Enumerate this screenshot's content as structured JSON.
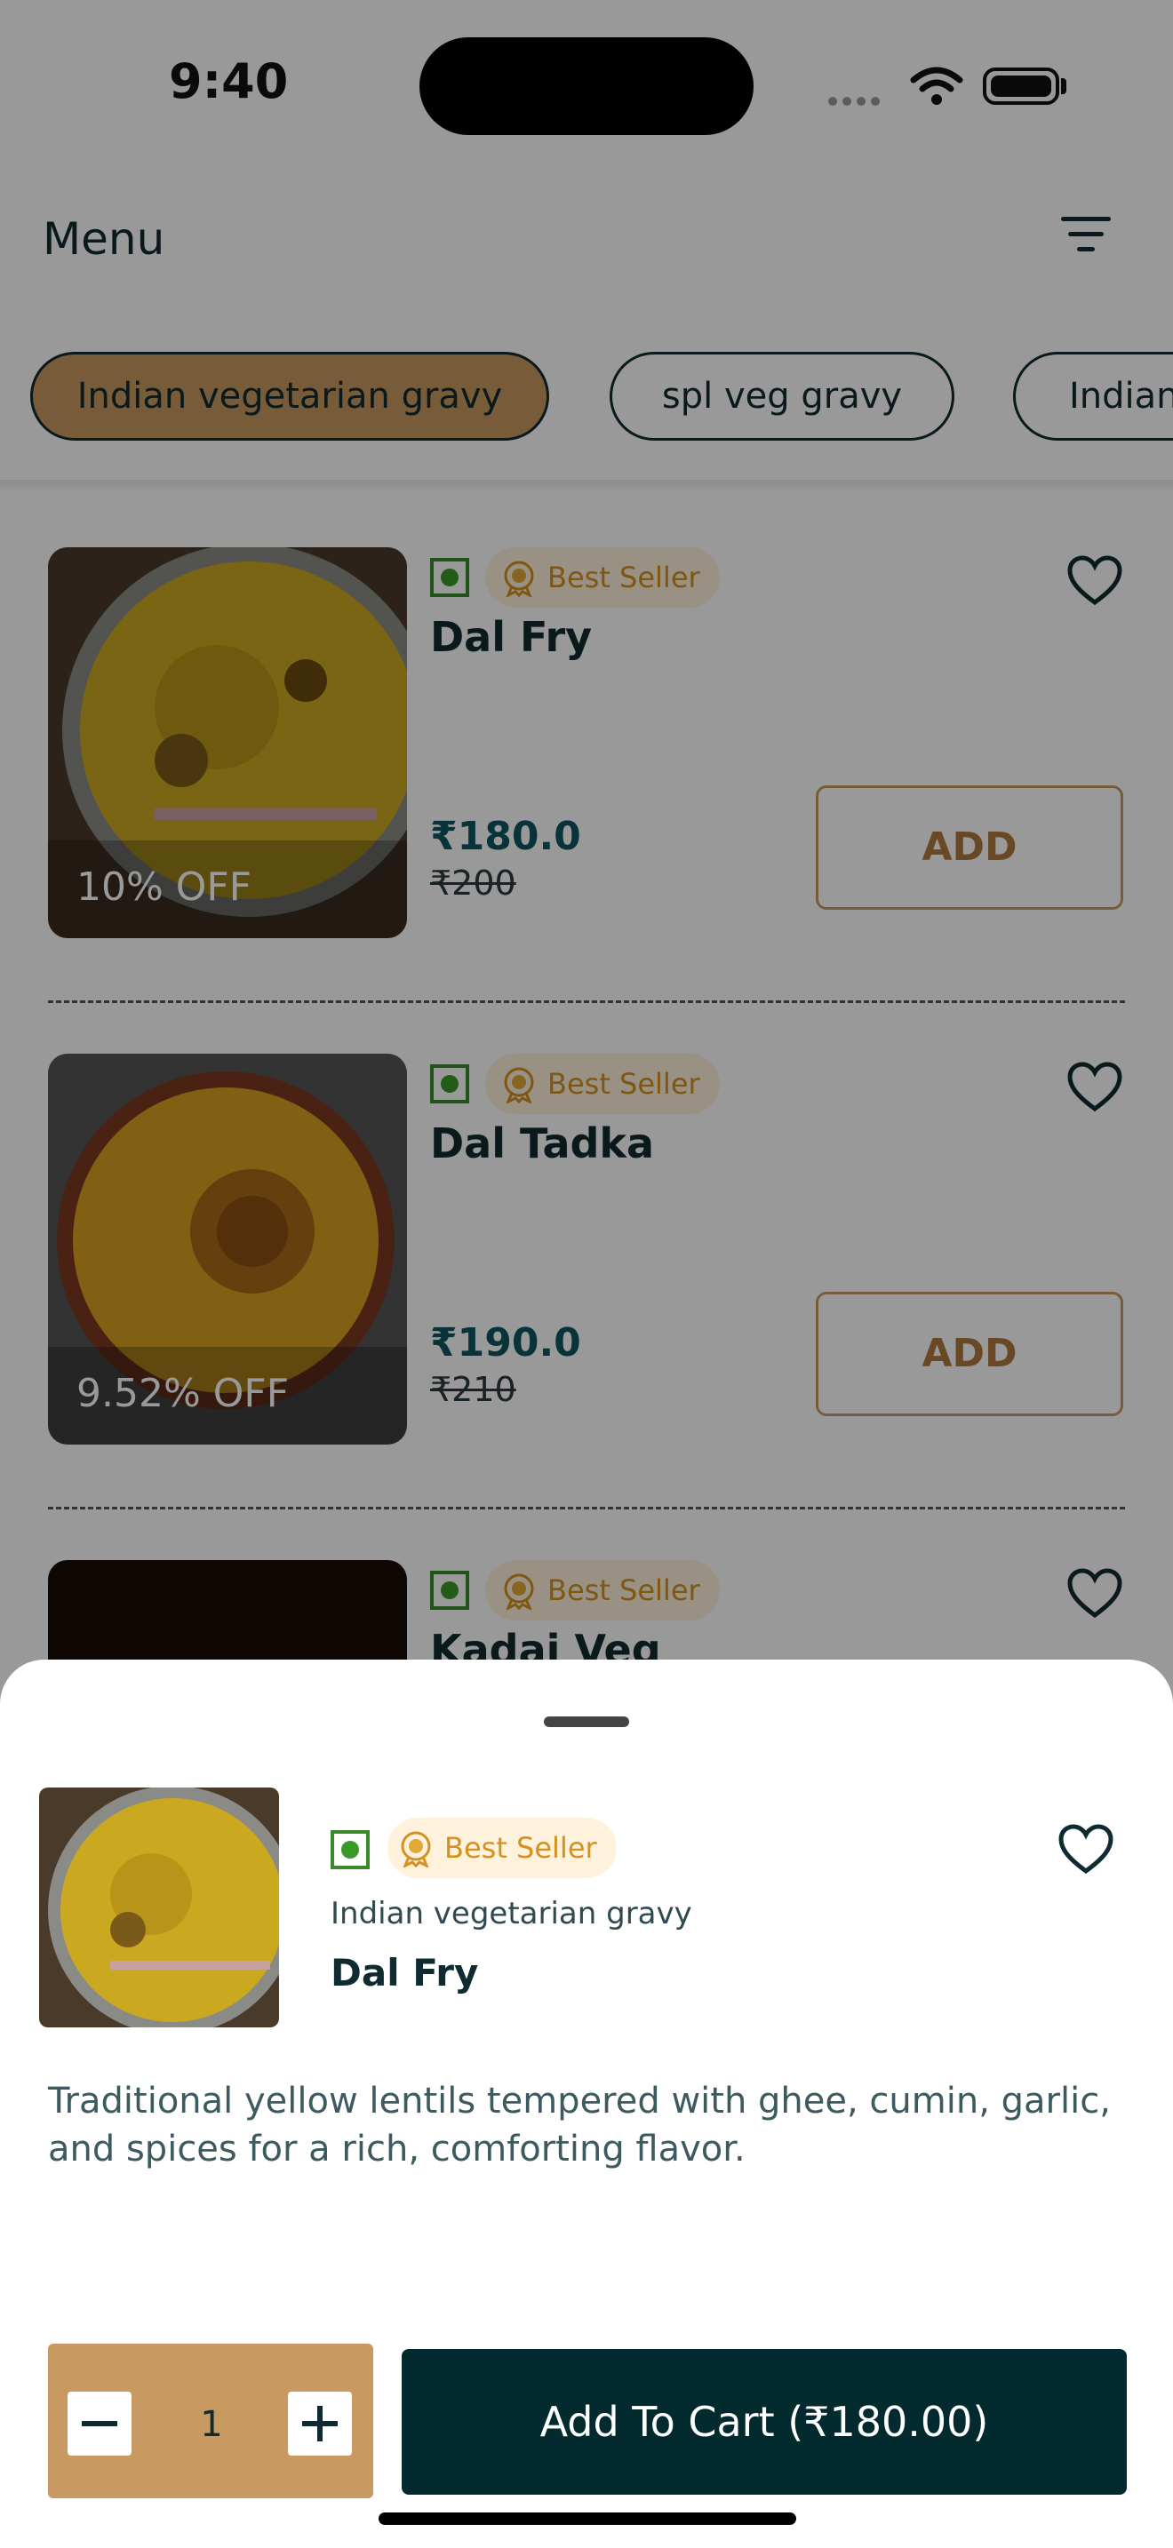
{
  "status_bar": {
    "time": "9:40"
  },
  "header": {
    "title": "Menu"
  },
  "categories": [
    {
      "label": "Indian vegetarian gravy",
      "active": true
    },
    {
      "label": "spl veg gravy",
      "active": false
    },
    {
      "label": "Indian",
      "active": false
    }
  ],
  "items": [
    {
      "name": "Dal Fry",
      "badge": "Best Seller",
      "price": "₹180.0",
      "mrp": "₹200",
      "discount": "10% OFF",
      "add_label": "ADD"
    },
    {
      "name": "Dal Tadka",
      "badge": "Best Seller",
      "price": "₹190.0",
      "mrp": "₹210",
      "discount": "9.52% OFF",
      "add_label": "ADD"
    },
    {
      "name": "Kadai Veg",
      "badge": "Best Seller"
    }
  ],
  "sheet": {
    "badge": "Best Seller",
    "category": "Indian vegetarian gravy",
    "name": "Dal Fry",
    "description": "Traditional yellow lentils tempered with ghee, cumin, garlic, and spices for a rich, comforting flavor.",
    "quantity": "1",
    "cart_label": "Add To Cart (₹180.00)"
  },
  "colors": {
    "accent": "#c89a62",
    "primary_dark": "#032a2f",
    "price": "#0d5560",
    "veg_green": "#3a9a28",
    "badge_text": "#d49120"
  },
  "icons": [
    "wifi-icon",
    "battery-icon",
    "filter-icon",
    "veg-indicator-icon",
    "award-icon",
    "heart-icon",
    "minus-icon",
    "plus-icon"
  ]
}
